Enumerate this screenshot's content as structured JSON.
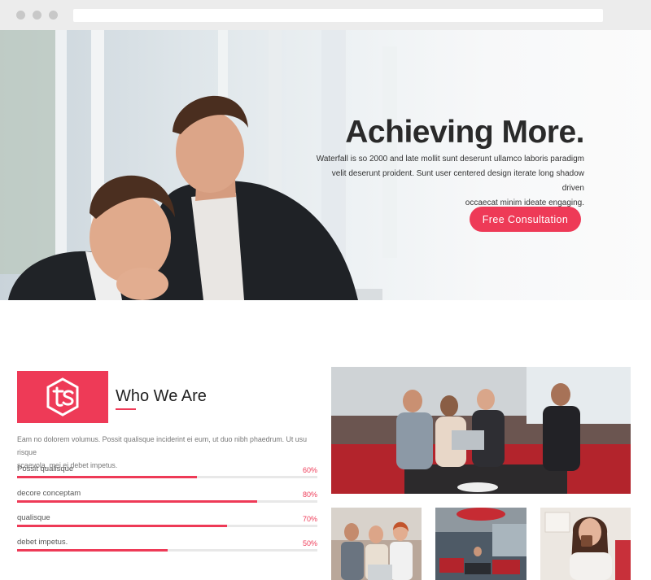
{
  "hero": {
    "title": "Achieving More.",
    "paragraph_lines": [
      "Waterfall is so 2000 and late mollit sunt deserunt ullamco laboris paradigm",
      "velit deserunt proident. Sunt user centered design iterate long shadow driven",
      "occaecat minim ideate engaging."
    ],
    "cta_label": "Free Consultation"
  },
  "about": {
    "title": "Who We Are",
    "intro_lines": [
      "Eam no dolorem volumus. Possit qualisque inciderint ei eum, ut duo nibh phaedrum. Ut usu risque",
      "scaevola, mei ei debet impetus."
    ],
    "skills": [
      {
        "label": "Possit qualisque",
        "percent_label": "60%",
        "value": 60
      },
      {
        "label": "decore conceptam",
        "percent_label": "80%",
        "value": 80
      },
      {
        "label": "qualisque",
        "percent_label": "70%",
        "value": 70
      },
      {
        "label": "debet impetus.",
        "percent_label": "50%",
        "value": 50
      }
    ]
  },
  "colors": {
    "accent": "#ee3a57"
  },
  "icons": [
    "brand-logo-icon"
  ]
}
